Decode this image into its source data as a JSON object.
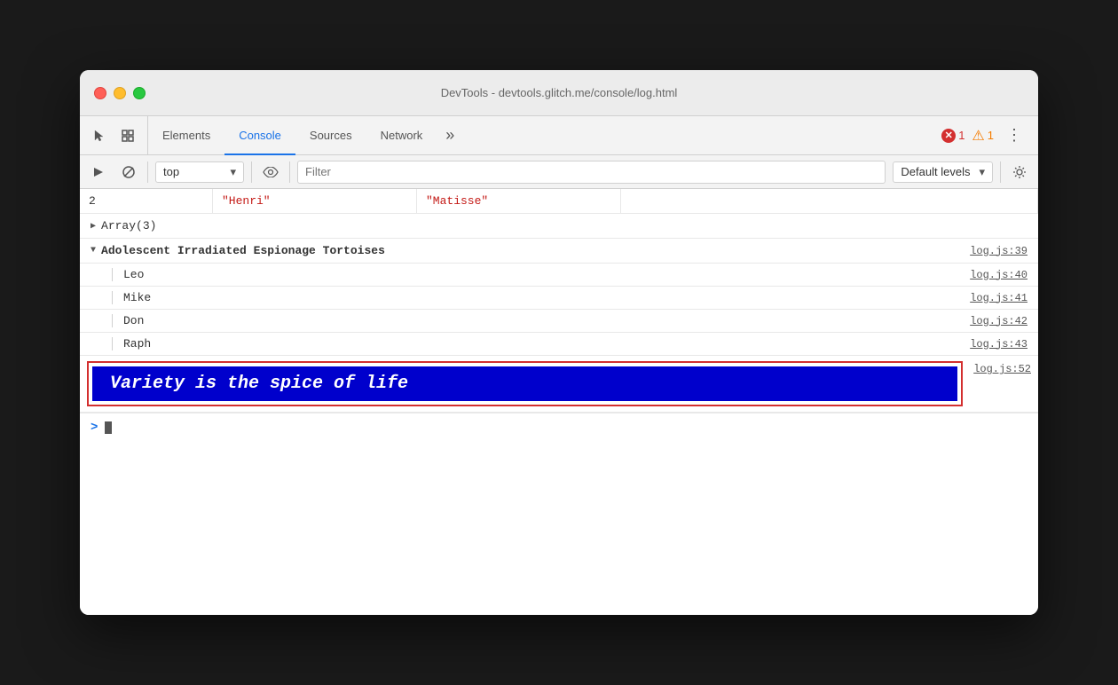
{
  "window": {
    "title": "DevTools - devtools.glitch.me/console/log.html"
  },
  "toolbar": {
    "tabs": [
      {
        "id": "elements",
        "label": "Elements",
        "active": false
      },
      {
        "id": "console",
        "label": "Console",
        "active": true
      },
      {
        "id": "sources",
        "label": "Sources",
        "active": false
      },
      {
        "id": "network",
        "label": "Network",
        "active": false
      }
    ],
    "more_label": "»",
    "error_count": "1",
    "warning_count": "1",
    "menu_icon": "⋮"
  },
  "console_toolbar": {
    "context": "top",
    "filter_placeholder": "Filter",
    "levels_label": "Default levels",
    "eye_icon": "👁"
  },
  "console": {
    "table_row": {
      "index": "2",
      "col1": "\"Henri\"",
      "col2": "\"Matisse\""
    },
    "array_label": "▶ Array(3)",
    "group": {
      "header": "Adolescent Irradiated Espionage Tortoises",
      "header_link": "log.js:39",
      "items": [
        {
          "text": "Leo",
          "link": "log.js:40"
        },
        {
          "text": "Mike",
          "link": "log.js:41"
        },
        {
          "text": "Don",
          "link": "log.js:42"
        },
        {
          "text": "Raph",
          "link": "log.js:43"
        }
      ]
    },
    "styled_log": {
      "text": "Variety is the spice of life",
      "link": "log.js:52",
      "border_color": "#d32f2f",
      "bg_color": "#0000cc",
      "text_color": "#ffffff"
    },
    "prompt_symbol": ">"
  }
}
